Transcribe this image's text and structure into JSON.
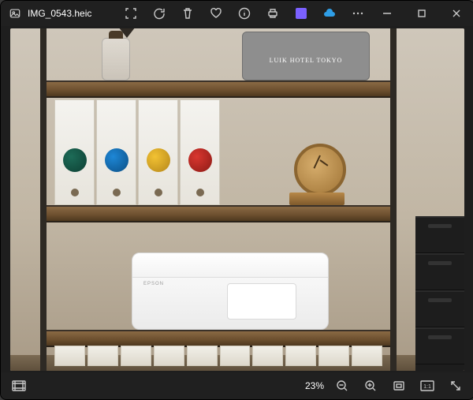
{
  "titlebar": {
    "filename": "IMG_0543.heic",
    "icons": {
      "app": "photos-app-icon",
      "zoom_toggle": "focus-frame-icon",
      "rotate": "rotate-icon",
      "delete": "trash-icon",
      "favorite": "heart-icon",
      "info": "info-icon",
      "print": "print-icon",
      "clipchamp": "clipchamp-icon",
      "onedrive": "cloud-icon",
      "more": "more-icon"
    },
    "window_controls": {
      "minimize": "minimize",
      "maximize": "maximize",
      "close": "close"
    }
  },
  "photo_content": {
    "storage_box_text": "LUIK HOTEL TOKYO",
    "printer_brand": "EPSON"
  },
  "bottombar": {
    "filmstrip_icon": "filmstrip-icon",
    "zoom_label": "23%",
    "zoom_out": "zoom-out-icon",
    "zoom_in": "zoom-in-icon",
    "fit": "fit-screen-icon",
    "actual": "actual-size-icon",
    "fullscreen": "fullscreen-icon"
  }
}
